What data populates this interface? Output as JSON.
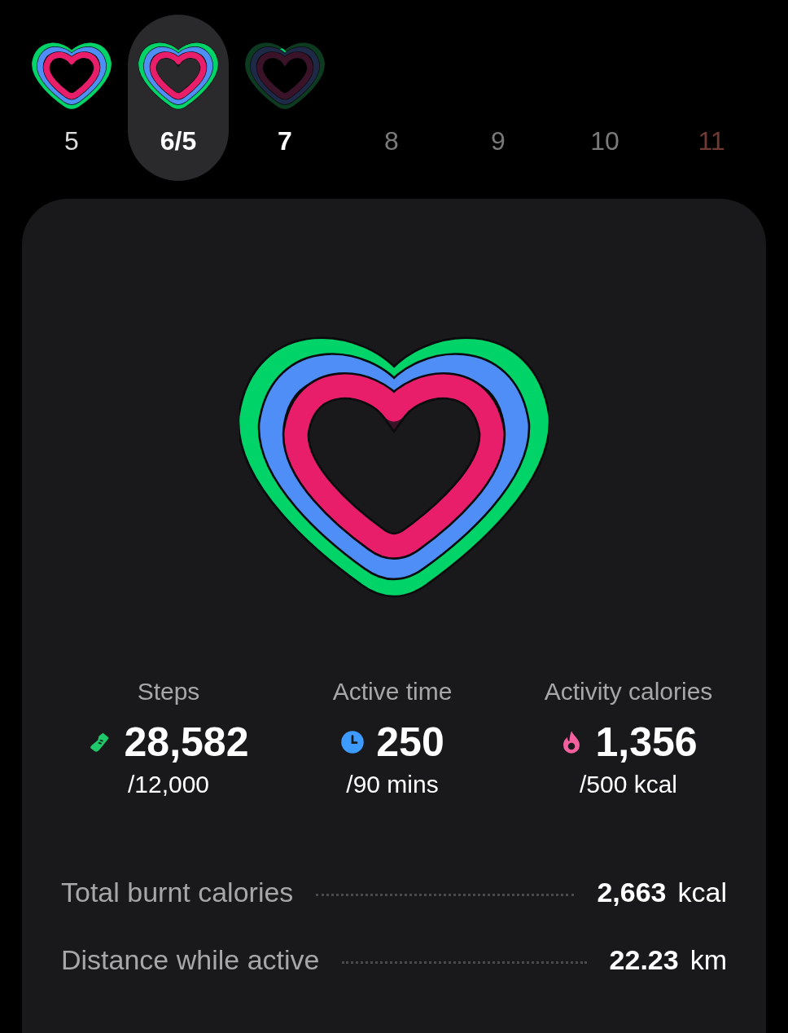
{
  "days": [
    {
      "label": "5",
      "kind": "past",
      "selected": false,
      "goals_met": true
    },
    {
      "label": "6/5",
      "kind": "past",
      "selected": true,
      "goals_met": true
    },
    {
      "label": "7",
      "kind": "today",
      "selected": false,
      "goals_met": false
    },
    {
      "label": "8",
      "kind": "future",
      "selected": false
    },
    {
      "label": "9",
      "kind": "future",
      "selected": false
    },
    {
      "label": "10",
      "kind": "future",
      "selected": false
    },
    {
      "label": "11",
      "kind": "holiday",
      "selected": false
    }
  ],
  "metrics": [
    {
      "kind": "steps",
      "label": "Steps",
      "value": "28,582",
      "goal": "/12,000"
    },
    {
      "kind": "time",
      "label": "Active time",
      "value": "250",
      "goal": "/90 mins"
    },
    {
      "kind": "calories",
      "label": "Activity calories",
      "value": "1,356",
      "goal": "/500 kcal"
    }
  ],
  "stats": [
    {
      "label": "Total burnt calories",
      "value": "2,663",
      "unit": "kcal"
    },
    {
      "label": "Distance while active",
      "value": "22.23",
      "unit": "km"
    }
  ]
}
